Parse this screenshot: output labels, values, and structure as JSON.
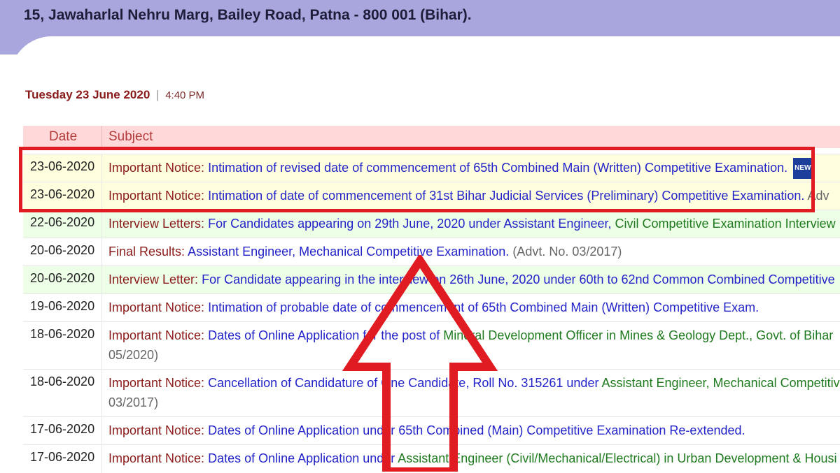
{
  "header": {
    "address": "15, Jawaharlal Nehru Marg, Bailey Road, Patna - 800 001 (Bihar)."
  },
  "datetime": {
    "date": "Tuesday 23 June 2020",
    "separator": "|",
    "time": "4:40 PM"
  },
  "table": {
    "columns": [
      "Date",
      "Subject"
    ],
    "rows": [
      {
        "date": "23-06-2020",
        "category": "Important Notice:",
        "text": "Intimation of revised date of commencement of 65th Combined Main (Written) Competitive Examination.",
        "badge": "NEW"
      },
      {
        "date": "23-06-2020",
        "category": "Important Notice:",
        "text": "Intimation of date of commencement of 31st Bihar Judicial Services (Preliminary) Competitive Examination.",
        "tail": "Adv"
      },
      {
        "date": "22-06-2020",
        "category": "Interview Letters:",
        "text": "For Candidates appearing on 29th June, 2020 under Assistant Engineer,",
        "green": "Civil Competitive Examination Interview"
      },
      {
        "date": "20-06-2020",
        "category": "Final Results:",
        "text": "Assistant Engineer, Mechanical Competitive Examination.",
        "tail": "(Advt. No. 03/2017)"
      },
      {
        "date": "20-06-2020",
        "category": "Interview Letter:",
        "text": "For Candidate appearing in the interview on 26th June, 2020 under 60th to 62nd Common Combined Competitive"
      },
      {
        "date": "19-06-2020",
        "category": "Important Notice:",
        "text": "Intimation of probable date of commencement of 65th Combined Main (Written) Competitive Exam."
      },
      {
        "date": "18-06-2020",
        "category": "Important Notice:",
        "text": "Dates of Online Application for the post of",
        "green": "Mineral Development Officer in Mines & Geology Dept., Govt. of Bihar",
        "line2": "05/2020)"
      },
      {
        "date": "18-06-2020",
        "category": "Important Notice:",
        "text": "Cancellation of Candidature of One Candidate, Roll No. 315261 under",
        "green": "Assistant Engineer, Mechanical Competitive",
        "line2": "03/2017)"
      },
      {
        "date": "17-06-2020",
        "category": "Important Notice:",
        "text": "Dates of Online Application under 65th Combined (Main) Competitive Examination Re-extended."
      },
      {
        "date": "17-06-2020",
        "category": "Important Notice:",
        "text": "Dates of Online Application under",
        "green": "Assistant Engineer (Civil/Mechanical/Electrical) in Urban Development & Housi"
      }
    ]
  },
  "colors": {
    "header_bar": "#a9a6de",
    "highlight_border": "#e11b22",
    "arrow": "#e11b22",
    "link": "#2323c8",
    "category": "#8a1b1b",
    "green_text": "#1f7a1f",
    "row_yellow": "#ffffe0",
    "row_green": "#eeffe8",
    "header_row": "#ffd9d9"
  },
  "annotations": {
    "highlight_box": "red-rectangle-highlight",
    "arrow": "red-up-arrow"
  }
}
